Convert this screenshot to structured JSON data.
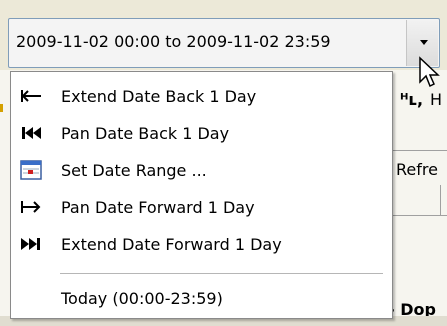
{
  "date_range_combo": {
    "value": "2009-11-02 00:00 to 2009-11-02 23:59"
  },
  "background": {
    "header_h": "H",
    "refresh_label": "Refre",
    "bottom_label": "- Dop"
  },
  "menu": {
    "items": [
      {
        "label": "Extend Date Back 1 Day",
        "icon": "extend-back-icon"
      },
      {
        "label": "Pan Date Back 1 Day",
        "icon": "pan-back-icon"
      },
      {
        "label": "Set Date Range ...",
        "icon": "calendar-icon"
      },
      {
        "label": "Pan Date Forward 1 Day",
        "icon": "pan-forward-icon"
      },
      {
        "label": "Extend Date Forward 1 Day",
        "icon": "extend-forward-icon"
      },
      {
        "label": "Today (00:00-23:59)",
        "icon": ""
      }
    ]
  }
}
